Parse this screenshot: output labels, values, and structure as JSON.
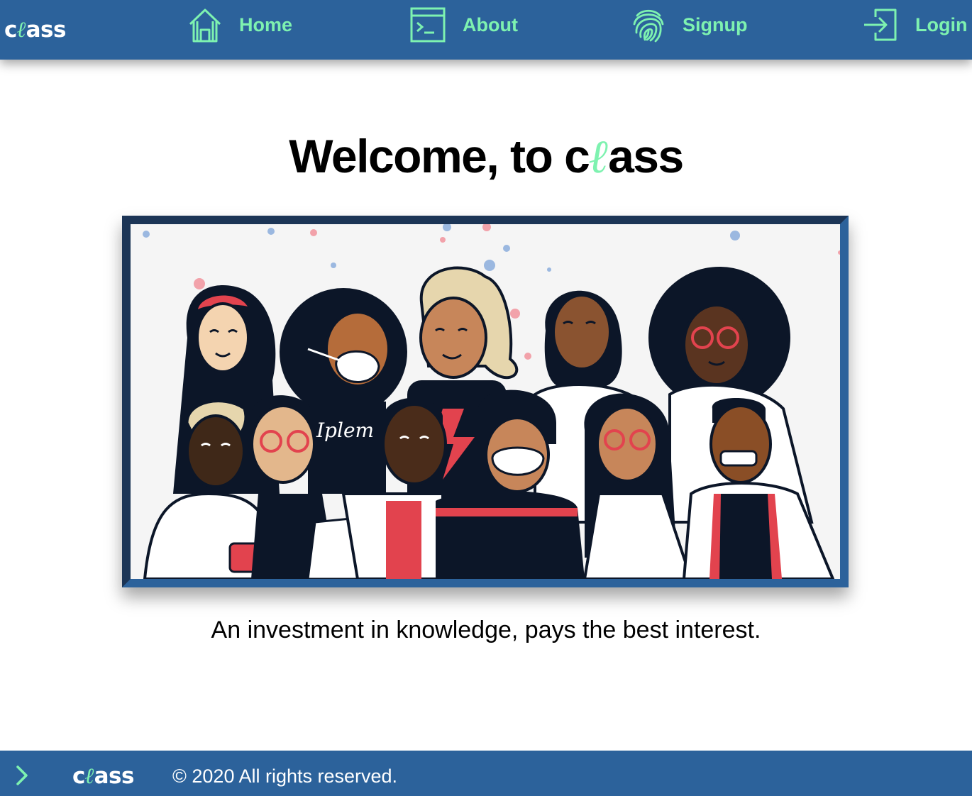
{
  "brand": {
    "prefix": "c",
    "accent": "ℓ",
    "suffix": "ass"
  },
  "nav": {
    "home": "Home",
    "about": "About",
    "signup": "Signup",
    "login": "Login"
  },
  "hero": {
    "title_prefix": "Welcome, to c",
    "title_accent": "ℓ",
    "title_suffix": "ass",
    "tagline": "An investment in knowledge, pays the best interest."
  },
  "illustration": {
    "shirt_text": "Iplem"
  },
  "footer": {
    "copyright": "© 2020 All rights reserved."
  },
  "colors": {
    "primary": "#2c629b",
    "frame_dark": "#1c3556",
    "accent": "#7ef2b0",
    "text": "#000000",
    "illustration_red": "#e2434e",
    "illustration_navy": "#0c1628"
  },
  "icons": [
    "house-icon",
    "terminal-window-icon",
    "fingerprint-icon",
    "login-arrow-icon",
    "chevron-right-icon"
  ]
}
